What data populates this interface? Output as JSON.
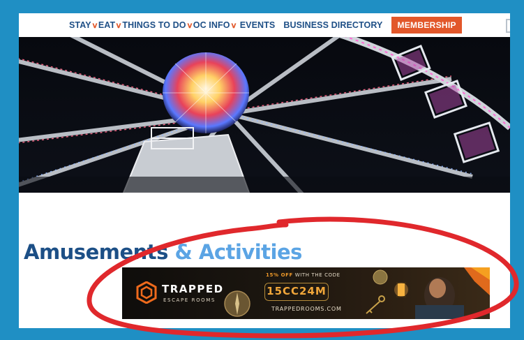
{
  "nav": {
    "items": [
      {
        "label": "STAY",
        "has_dropdown": true
      },
      {
        "label": "EAT",
        "has_dropdown": true
      },
      {
        "label": "THINGS TO DO",
        "has_dropdown": true
      },
      {
        "label": "OC INFO",
        "has_dropdown": true
      },
      {
        "label": "EVENTS",
        "has_dropdown": false
      },
      {
        "label": "BUSINESS DIRECTORY",
        "has_dropdown": false
      }
    ],
    "membership_label": "MEMBERSHIP",
    "dropdown_glyph": "∨"
  },
  "hero": {
    "image_icon": "ferris-wheel-photo"
  },
  "page": {
    "title_part1": "Amusements",
    "title_part2": "& Activities"
  },
  "ad": {
    "brand_name": "TRAPPED",
    "brand_sub": "ESCAPE ROOMS",
    "offer_highlight": "15% OFF",
    "offer_text": "WITH THE CODE",
    "promo_code": "15CC24M",
    "url": "TRAPPEDROOMS.COM"
  },
  "colors": {
    "frame": "#1f8fc4",
    "nav_text": "#1e4f86",
    "accent": "#e2572a",
    "title_dark": "#1c4f86",
    "title_light": "#5ba4e4",
    "annotation": "#e0282c"
  }
}
